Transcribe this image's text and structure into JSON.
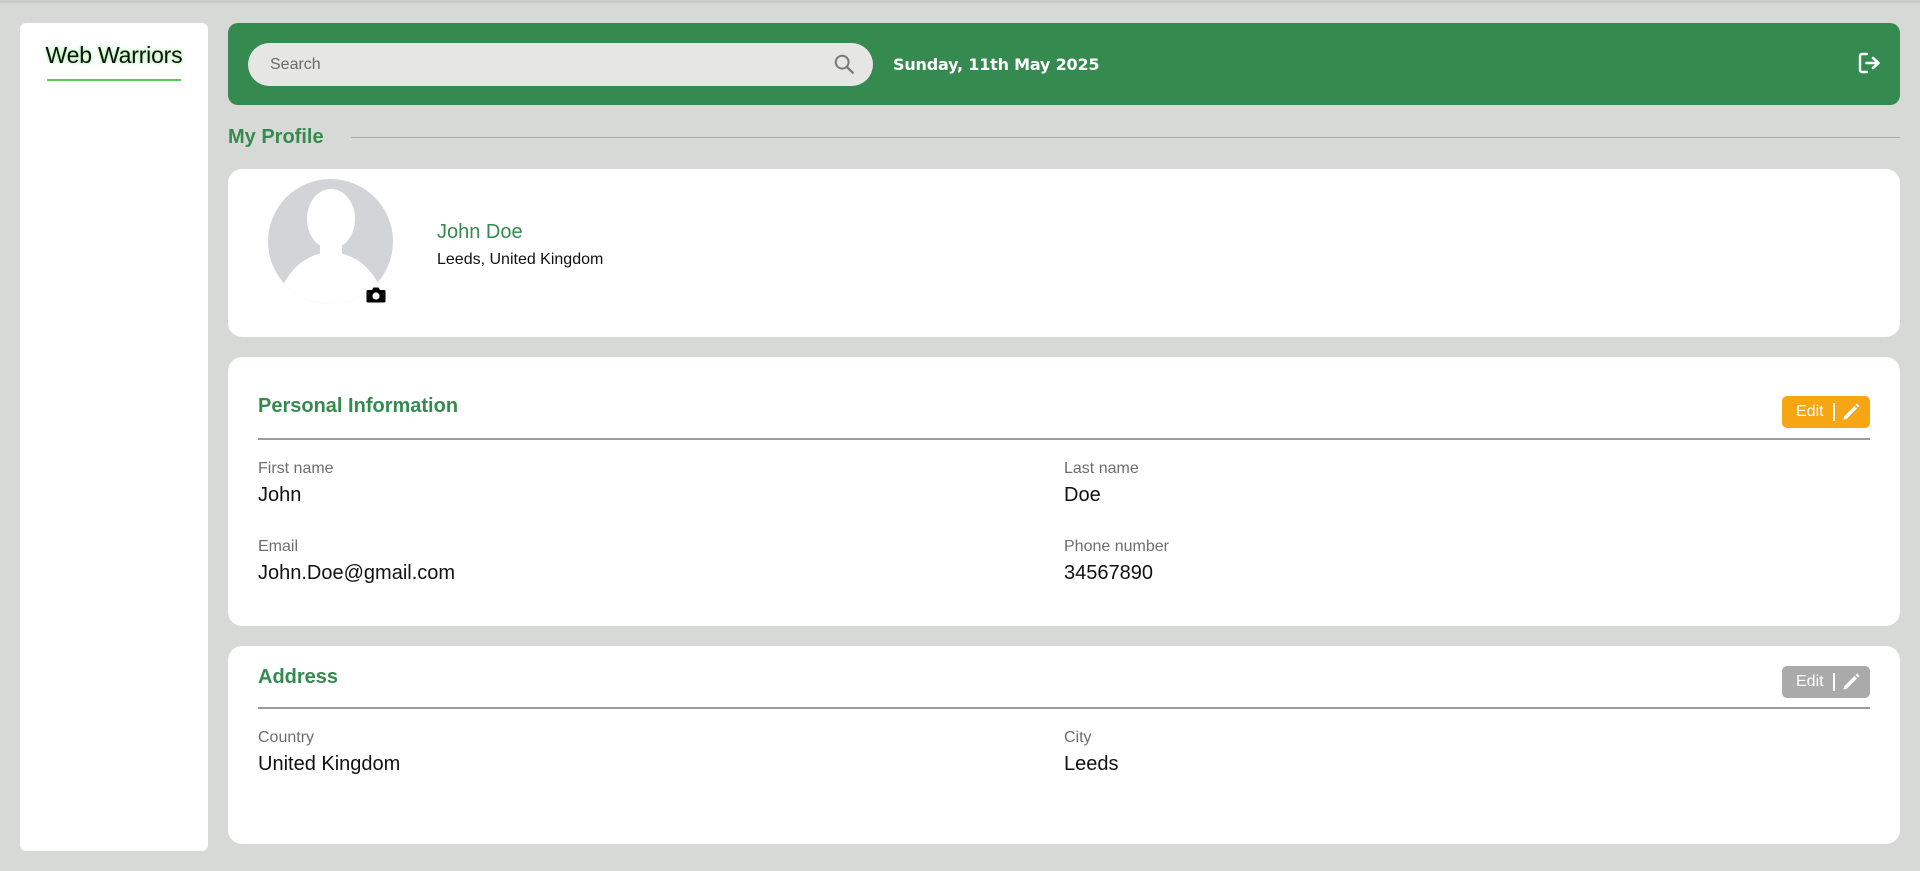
{
  "sidebar": {
    "brand": "Web Warriors"
  },
  "header": {
    "search_placeholder": "Search",
    "date": "Sunday, 11th May 2025"
  },
  "page": {
    "title": "My Profile"
  },
  "profile": {
    "name": "John Doe",
    "location": "Leeds, United Kingdom"
  },
  "personal": {
    "heading": "Personal Information",
    "edit_label": "Edit",
    "fields": [
      {
        "label": "First name",
        "value": "John"
      },
      {
        "label": "Last name",
        "value": "Doe"
      },
      {
        "label": "Email",
        "value": "John.Doe@gmail.com"
      },
      {
        "label": "Phone number",
        "value": "34567890"
      }
    ]
  },
  "address": {
    "heading": "Address",
    "edit_label": "Edit",
    "fields": [
      {
        "label": "Country",
        "value": "United Kingdom"
      },
      {
        "label": "City",
        "value": "Leeds"
      }
    ]
  },
  "colors": {
    "brand_green": "#348a4f",
    "edit_active": "#f5a612",
    "edit_disabled": "#aaaaaa"
  },
  "icons": [
    "search-icon",
    "logout-icon",
    "camera-icon",
    "pencil-icon",
    "avatar-placeholder"
  ]
}
